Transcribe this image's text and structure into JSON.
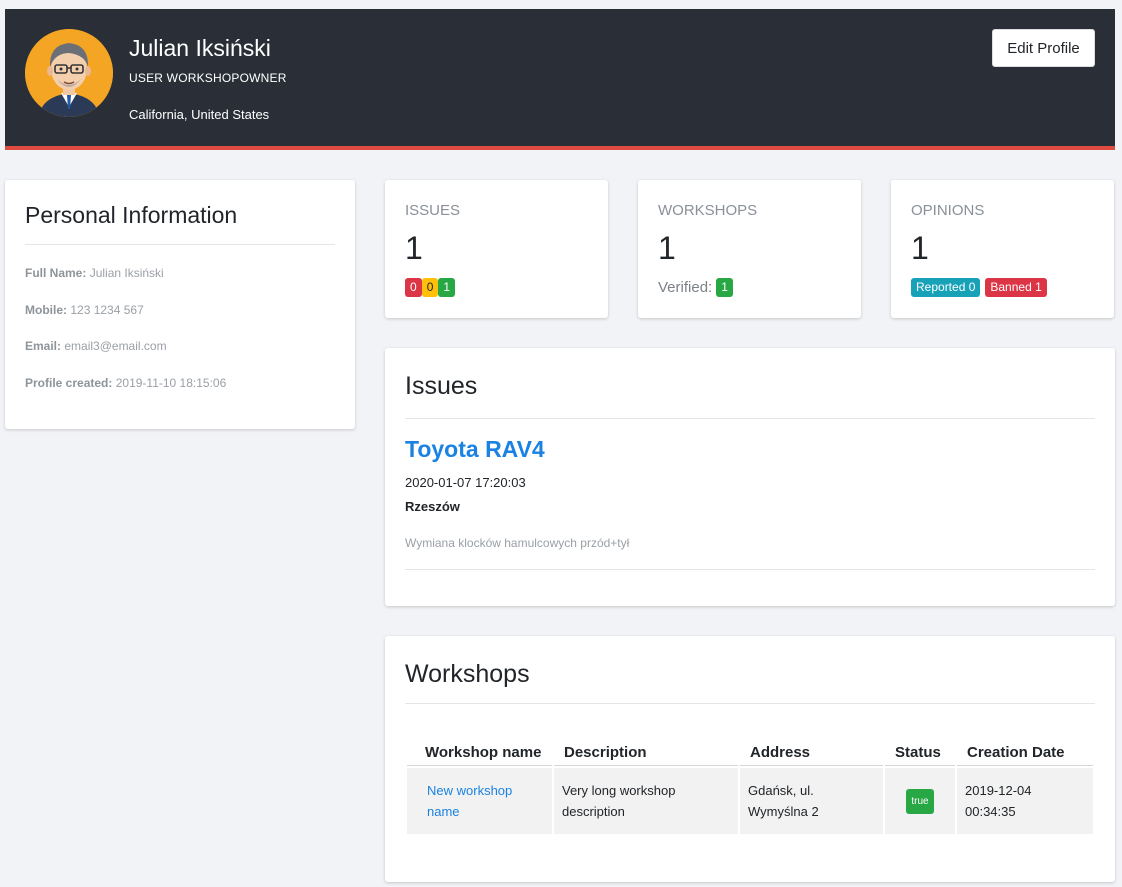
{
  "profile": {
    "name": "Julian Iksiński",
    "role": "USER WORKSHOPOWNER",
    "location": "California, United States",
    "edit_button": "Edit Profile"
  },
  "personal_info": {
    "title": "Personal Information",
    "full_name_label": "Full Name:",
    "full_name_value": "Julian Iksiński",
    "mobile_label": "Mobile:",
    "mobile_value": "123 1234 567",
    "email_label": "Email:",
    "email_value": "email3@email.com",
    "created_label": "Profile created:",
    "created_value": "2019-11-10 18:15:06"
  },
  "stats": {
    "issues": {
      "label": "ISSUES",
      "count": "1",
      "badges": [
        "0",
        "0",
        "1"
      ]
    },
    "workshops": {
      "label": "WORKSHOPS",
      "count": "1",
      "verified_label": "Verified:",
      "verified_count": "1"
    },
    "opinions": {
      "label": "OPINIONS",
      "count": "1",
      "reported": "Reported 0",
      "banned": "Banned 1"
    }
  },
  "issues_section": {
    "title": "Issues",
    "items": [
      {
        "title": "Toyota RAV4",
        "date": "2020-01-07 17:20:03",
        "city": "Rzeszów",
        "description": "Wymiana klocków hamulcowych przód+tył"
      }
    ]
  },
  "workshops_section": {
    "title": "Workshops",
    "headers": [
      "Workshop name",
      "Description",
      "Address",
      "Status",
      "Creation Date"
    ],
    "rows": [
      {
        "name": "New workshop name",
        "description": "Very long workshop description",
        "address": "Gdańsk, ul. Wymyślna 2",
        "status": "true",
        "created": "2019-12-04 00:34:35"
      }
    ]
  },
  "colors": {
    "header_bg": "#2a2f37",
    "accent_red": "#e04b41",
    "link_blue": "#1a82e2",
    "badge_red": "#dc3545",
    "badge_yellow": "#ffc107",
    "badge_green": "#28a745",
    "badge_cyan": "#17a2b8"
  }
}
